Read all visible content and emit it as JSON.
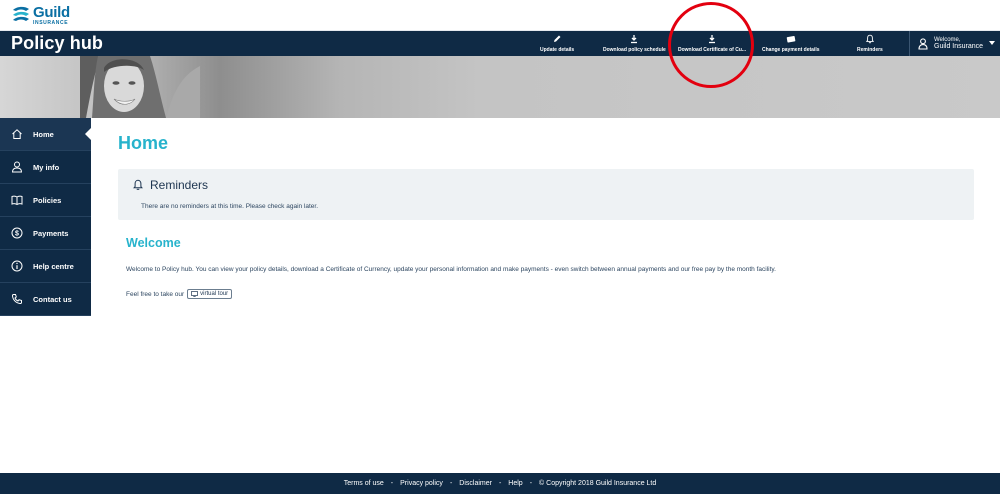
{
  "logo": {
    "name": "Guild",
    "sub": "INSURANCE"
  },
  "header": {
    "brand": "Policy hub",
    "actions": [
      {
        "label": "Update details",
        "icon": "pencil-icon"
      },
      {
        "label": "Download policy schedule",
        "icon": "download-icon"
      },
      {
        "label": "Download Certificate of Cu...",
        "icon": "download-icon"
      },
      {
        "label": "Change payment details",
        "icon": "card-icon"
      },
      {
        "label": "Reminders",
        "icon": "bell-icon"
      }
    ],
    "user": {
      "greeting": "Welcome,",
      "name": "Guild Insurance"
    }
  },
  "sidebar": {
    "items": [
      {
        "label": "Home",
        "icon": "home-icon",
        "active": true
      },
      {
        "label": "My info",
        "icon": "person-icon"
      },
      {
        "label": "Policies",
        "icon": "book-icon"
      },
      {
        "label": "Payments",
        "icon": "dollar-icon"
      },
      {
        "label": "Help centre",
        "icon": "info-icon"
      },
      {
        "label": "Contact us",
        "icon": "phone-icon"
      }
    ]
  },
  "main": {
    "title": "Home",
    "reminders": {
      "title": "Reminders",
      "message": "There are no reminders at this time. Please check again later."
    },
    "welcome": {
      "title": "Welcome",
      "body": "Welcome to Policy hub. You can view your policy details, download a Certificate of Currency, update your personal information and make payments - even switch between annual payments and our free pay by the month facility.",
      "tour_prefix": "Feel free to take our",
      "tour_button": "virtual tour"
    }
  },
  "footer": {
    "links": [
      "Terms of use",
      "Privacy policy",
      "Disclaimer",
      "Help"
    ],
    "copyright": "© Copyright 2018 Guild Insurance Ltd"
  },
  "colors": {
    "navy": "#0f2a45",
    "accent_teal": "#27b3cc",
    "logo_blue": "#0a6fa3",
    "annotation_red": "#e3000f"
  }
}
